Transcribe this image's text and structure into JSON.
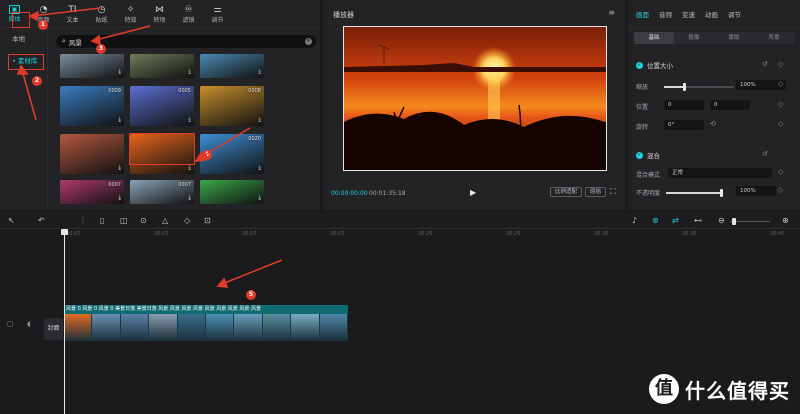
{
  "media_panel": {
    "tool_tabs": [
      {
        "label": "媒体",
        "icon": "media-icon",
        "glyph": "▣"
      },
      {
        "label": "音频",
        "icon": "audio-icon",
        "glyph": "◔"
      },
      {
        "label": "文本",
        "icon": "text-icon",
        "glyph": "TI"
      },
      {
        "label": "贴纸",
        "icon": "sticker-icon",
        "glyph": "◷"
      },
      {
        "label": "特效",
        "icon": "effects-icon",
        "glyph": "✧"
      },
      {
        "label": "转场",
        "icon": "transition-icon",
        "glyph": "⋈"
      },
      {
        "label": "滤镜",
        "icon": "filter-icon",
        "glyph": "♾"
      },
      {
        "label": "调节",
        "icon": "adjust-icon",
        "glyph": "⚌"
      }
    ],
    "side_nav": [
      {
        "label": "本地"
      },
      {
        "label": "• 素材库"
      }
    ],
    "search": {
      "value": "风景",
      "placeholder": "搜索"
    },
    "thumbnails": [
      {
        "duration": "",
        "color": "#7b8fa1"
      },
      {
        "duration": "",
        "color": "#6d7d5a"
      },
      {
        "duration": "",
        "color": "#4b8ab5"
      },
      {
        "duration": "0009",
        "color": "#3a7dc2"
      },
      {
        "duration": "0005",
        "color": "#5b6fd0"
      },
      {
        "duration": "0008",
        "color": "#c78f2b"
      },
      {
        "duration": "",
        "color": "#b5583f"
      },
      {
        "duration": "",
        "color": "#e8641a"
      },
      {
        "duration": "0020",
        "color": "#3e8fd6"
      },
      {
        "duration": "0007",
        "color": "#b03a6b"
      },
      {
        "duration": "0007",
        "color": "#8aa4b8"
      },
      {
        "duration": "",
        "color": "#3aa84a"
      }
    ]
  },
  "player": {
    "title": "播放器",
    "menu_glyph": "≡",
    "current_time": "00:00:00:00",
    "total_time": "00:01:35:18",
    "play_glyph": "▶",
    "ratio_label": "比例适配",
    "original_label": "原始",
    "fullscreen_glyph": "⛶"
  },
  "properties": {
    "tabs": [
      "画面",
      "音频",
      "变速",
      "动画",
      "调节"
    ],
    "sub_tabs": [
      "基础",
      "抠像",
      "蒙版",
      "背景"
    ],
    "position_size": {
      "title": "位置大小",
      "scale_label": "缩放",
      "scale_value": "100%",
      "position_label": "位置",
      "pos_x": "0",
      "pos_y": "0",
      "rotate_label": "旋转",
      "rotate_value": "0°"
    },
    "blend": {
      "title": "混合",
      "mode_label": "混合模式",
      "mode_value": "正常",
      "opacity_label": "不透明度",
      "opacity_value": "100%"
    }
  },
  "timeline": {
    "ruler_labels": [
      "00:00",
      "00:05",
      "00:10",
      "00:15",
      "00:20",
      "00:25",
      "00:30",
      "00:35",
      "00:40"
    ],
    "cover_label": "封面",
    "clip_labels": "风景 0 风景 0 风景 0 美景日落 美景日落 风景 风景 风景 风景 风景 风景 风景 风景 风景",
    "clip_colors": [
      "#e26a1f",
      "#6b8fb3",
      "#5a7fa8",
      "#8c9bb0",
      "#3a6f8c",
      "#4f8fb5",
      "#6a9dbd",
      "#5b8fa0",
      "#7aaec4",
      "#4e86a8"
    ]
  },
  "annotations": [
    "1",
    "2",
    "3",
    "4",
    "5"
  ],
  "watermark": {
    "logo_glyph": "值",
    "text": "什么值得买"
  }
}
